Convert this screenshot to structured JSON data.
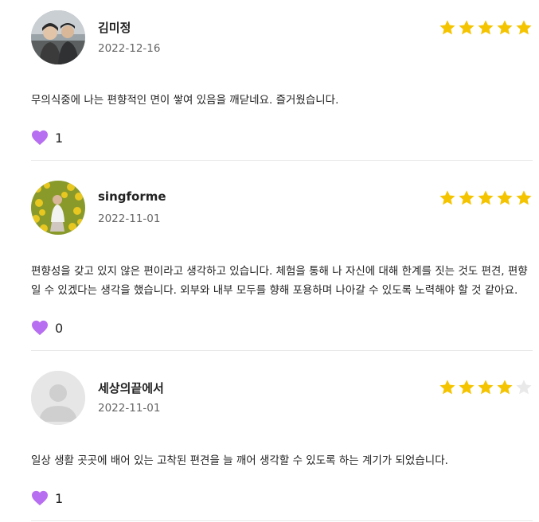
{
  "reviews": [
    {
      "name": "김미정",
      "date": "2022-12-16",
      "rating": 5,
      "text": "무의식중에 나는 편향적인 면이 쌓여 있음을 깨닫네요. 즐거웠습니다.",
      "likes": "1",
      "avatar": "photo-couple"
    },
    {
      "name": "singforme",
      "date": "2022-11-01",
      "rating": 5,
      "text": "편향성을 갖고 있지 않은 편이라고 생각하고 있습니다. 체험을 통해 나 자신에 대해 한계를 짓는 것도 편견, 편향일 수 있겠다는 생각을 했습니다. 외부와 내부 모두를 향해 포용하며 나아갈 수 있도록 노력해야 할 것 같아요.",
      "likes": "0",
      "avatar": "photo-flowers"
    },
    {
      "name": "세상의끝에서",
      "date": "2022-11-01",
      "rating": 4,
      "text": "일상 생활 곳곳에 배어 있는 고착된 편견을 늘 깨어 생각할 수 있도록 하는 계기가 되었습니다.",
      "likes": "1",
      "avatar": "default-user"
    }
  ],
  "colors": {
    "star_filled": "#f5c400",
    "star_empty": "#e9e9e9",
    "heart": "#b76ef0",
    "divider": "#e8e8e8"
  }
}
